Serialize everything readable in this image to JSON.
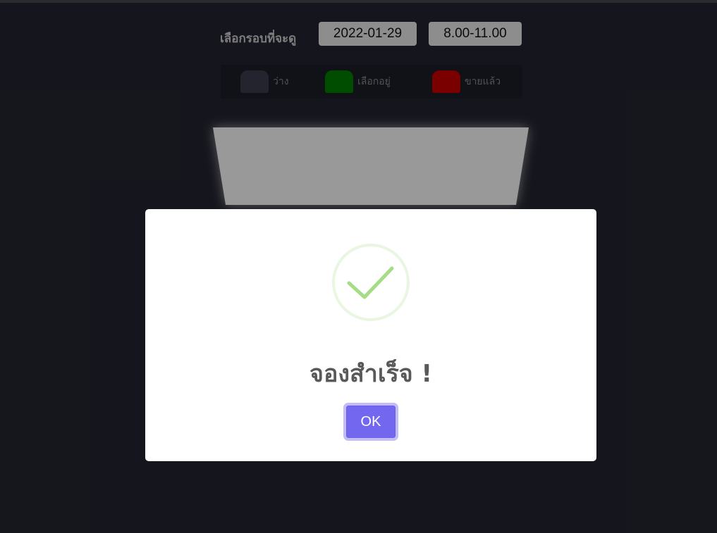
{
  "booking": {
    "round_label": "เลือกรอบที่จะดู",
    "date": "2022-01-29",
    "time": "8.00-11.00"
  },
  "legend": {
    "items": [
      {
        "label": "ว่าง",
        "color": "#3b3c4c"
      },
      {
        "label": "เลือกอยู่",
        "color": "#008000"
      },
      {
        "label": "ขายแล้ว",
        "color": "#cc0000"
      }
    ]
  },
  "screen": {
    "color": "#ffffff"
  },
  "dialog": {
    "icon": "check-circle-icon",
    "title": "จองสำเร็จ !",
    "ok_label": "OK",
    "accent": "#7367f0",
    "success_color": "#a5dc86"
  }
}
